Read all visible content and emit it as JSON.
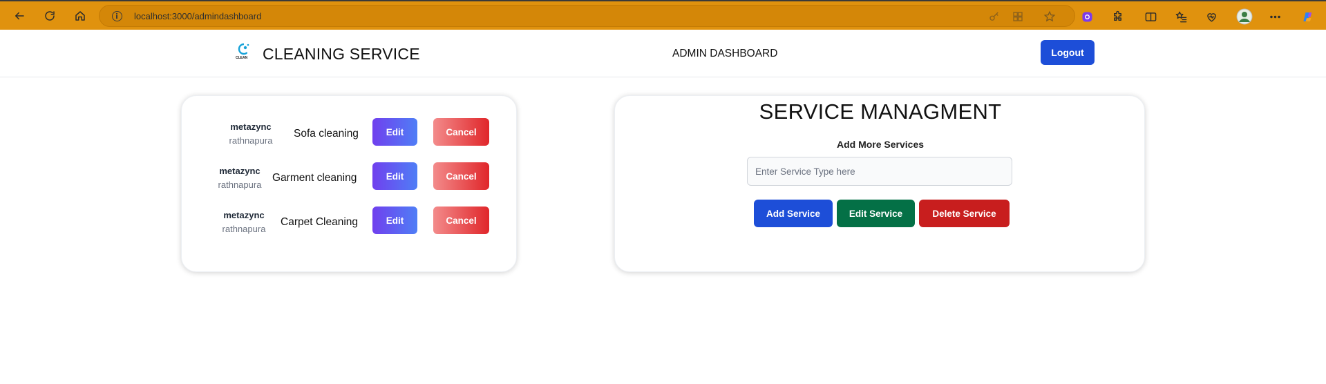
{
  "browser": {
    "url": "localhost:3000/admindashboard",
    "bar_color": "#e0920e",
    "nav_icons": [
      "back-icon",
      "refresh-icon",
      "home-icon"
    ],
    "toolbar_icons": [
      "key-icon",
      "apps-icon",
      "favorite-star-icon",
      "extension-badge-icon",
      "extensions-puzzle-icon",
      "split-screen-icon",
      "favorites-list-icon",
      "performance-heart-icon",
      "profile-avatar-icon",
      "more-menu-icon",
      "copilot-icon"
    ]
  },
  "header": {
    "brand": "CLEANING SERVICE",
    "page_title": "ADMIN DASHBOARD",
    "logout_label": "Logout",
    "logo_text": "CLEAN"
  },
  "bookings": [
    {
      "customer": "metazync",
      "location": "rathnapura",
      "service": "Sofa cleaning",
      "edit_label": "Edit",
      "cancel_label": "Cancel"
    },
    {
      "customer": "metazync",
      "location": "rathnapura",
      "service": "Garment cleaning",
      "edit_label": "Edit",
      "cancel_label": "Cancel"
    },
    {
      "customer": "metazync",
      "location": "rathnapura",
      "service": "Carpet Cleaning",
      "edit_label": "Edit",
      "cancel_label": "Cancel"
    }
  ],
  "service_management": {
    "title": "SERVICE MANAGMENT",
    "subtitle": "Add More Services",
    "input_placeholder": "Enter Service Type here",
    "input_value": "",
    "add_label": "Add Service",
    "edit_label": "Edit Service",
    "delete_label": "Delete Service"
  },
  "colors": {
    "primary_blue": "#1d4ed8",
    "green": "#047046",
    "red": "#c81e1e"
  }
}
